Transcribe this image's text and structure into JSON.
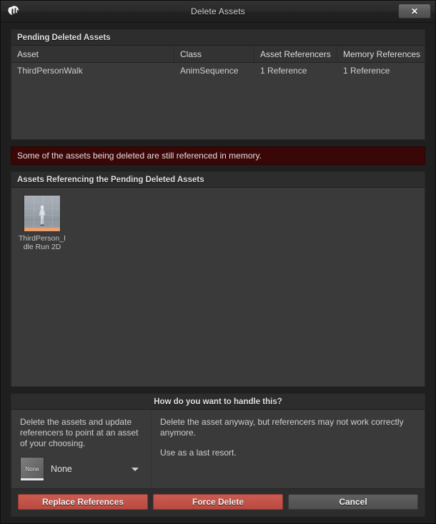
{
  "window": {
    "title": "Delete Assets",
    "logo_icon": "unreal-engine-logo",
    "close_icon": "✕"
  },
  "pending_assets": {
    "header": "Pending Deleted Assets",
    "columns": [
      "Asset",
      "Class",
      "Asset Referencers",
      "Memory References"
    ],
    "rows": [
      {
        "asset": "ThirdPersonWalk",
        "class": "AnimSequence",
        "asset_referencers": "1 Reference",
        "memory_references": "1 Reference"
      }
    ]
  },
  "warning": {
    "message": "Some of the assets being deleted are still referenced in memory.",
    "background_color": "#3a0707"
  },
  "referencing_assets": {
    "header": "Assets Referencing the Pending Deleted Assets",
    "tiles": [
      {
        "label": "ThirdPerson_Idle Run 2D",
        "thumbnail_icon": "mannequin-thumbnail",
        "accent_color": "#eda170"
      }
    ]
  },
  "handle_section": {
    "header": "How do you want to handle this?",
    "left_option": {
      "description": "Delete the assets and update referencers to point at an asset of your choosing.",
      "picker": {
        "thumbnail_label": "None",
        "value": "None",
        "chevron_icon": "chevron-down-icon"
      }
    },
    "right_option": {
      "description": "Delete the asset anyway, but referencers may not work correctly anymore.",
      "note": "Use as a last resort."
    }
  },
  "actions": {
    "replace_references": "Replace References",
    "force_delete": "Force Delete",
    "cancel": "Cancel",
    "danger_color": "#c4544a",
    "neutral_color": "#585858"
  }
}
